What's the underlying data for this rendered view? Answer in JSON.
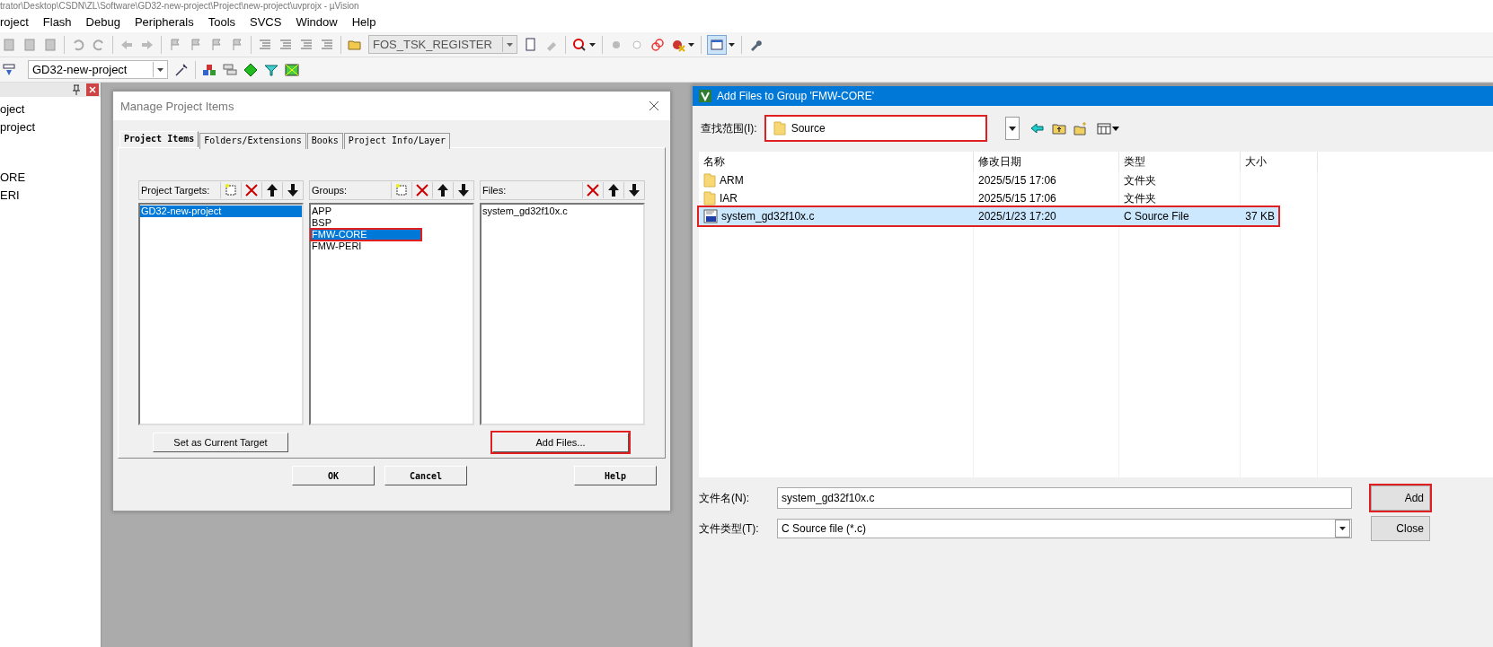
{
  "window": {
    "title": "trator\\Desktop\\CSDN\\ZL\\Software\\GD32-new-project\\Project\\new-project\\uvprojx - µVision"
  },
  "menu": [
    {
      "label": "roject"
    },
    {
      "label": "Flash"
    },
    {
      "label": "Debug"
    },
    {
      "label": "Peripherals"
    },
    {
      "label": "Tools"
    },
    {
      "label": "SVCS"
    },
    {
      "label": "Window"
    },
    {
      "label": "Help"
    }
  ],
  "toolbar": {
    "find_combo": {
      "value": "FOS_TSK_REGISTER",
      "disabled": true
    }
  },
  "build_toolbar": {
    "target_combo": {
      "value": "GD32-new-project"
    }
  },
  "project_panel": {
    "items": [
      {
        "label": "oject",
        "children": [
          {
            "label": "project",
            "children": [
              {
                "label": "ORE"
              },
              {
                "label": "ERI"
              }
            ]
          }
        ]
      }
    ]
  },
  "manage_dialog": {
    "title": "Manage Project Items",
    "tabs": [
      {
        "label": "Project Items",
        "selected": true
      },
      {
        "label": "Folders/Extensions",
        "selected": false
      },
      {
        "label": "Books",
        "selected": false
      },
      {
        "label": "Project Info/Layer",
        "selected": false
      }
    ],
    "panes": [
      {
        "label": "Project Targets:",
        "new_button": true,
        "items": [
          {
            "label": "GD32-new-project",
            "selected": true,
            "highlighted": false
          }
        ]
      },
      {
        "label": "Groups:",
        "new_button": true,
        "items": [
          {
            "label": "APP",
            "selected": false,
            "highlighted": false
          },
          {
            "label": "BSP",
            "selected": false,
            "highlighted": false
          },
          {
            "label": "FMW-CORE",
            "selected": true,
            "highlighted": true
          },
          {
            "label": "FMW-PERI",
            "selected": false,
            "highlighted": false
          }
        ]
      },
      {
        "label": "Files:",
        "new_button": false,
        "items": [
          {
            "label": "system_gd32f10x.c",
            "selected": false,
            "highlighted": false
          }
        ]
      }
    ],
    "set_target_button": {
      "label": "Set as Current Target",
      "highlighted": false
    },
    "add_files_button": {
      "label": "Add Files...",
      "highlighted": true
    },
    "footer_buttons": [
      {
        "label": "OK"
      },
      {
        "label": "Cancel"
      },
      {
        "label": "Help"
      }
    ]
  },
  "add_dialog": {
    "title": "Add Files to Group 'FMW-CORE'",
    "look_in": {
      "label": "查找范围(I):",
      "value": "Source",
      "highlighted": true
    },
    "columns": [
      "名称",
      "修改日期",
      "类型",
      "大小"
    ],
    "rows": [
      {
        "kind": "folder",
        "name": "ARM",
        "date": "2025/5/15 17:06",
        "type": "文件夹",
        "size": "",
        "selected": false,
        "highlighted": false
      },
      {
        "kind": "folder",
        "name": "IAR",
        "date": "2025/5/15 17:06",
        "type": "文件夹",
        "size": "",
        "selected": false,
        "highlighted": false
      },
      {
        "kind": "c-file",
        "name": "system_gd32f10x.c",
        "date": "2025/1/23 17:20",
        "type": "C Source File",
        "size": "37 KB",
        "selected": true,
        "highlighted": true
      }
    ],
    "file_name": {
      "label": "文件名(N):",
      "value": "system_gd32f10x.c"
    },
    "file_type": {
      "label": "文件类型(T):",
      "value": "C Source file (*.c)"
    },
    "buttons": [
      {
        "label": "Add",
        "highlighted": true
      },
      {
        "label": "Close",
        "highlighted": false
      }
    ]
  }
}
